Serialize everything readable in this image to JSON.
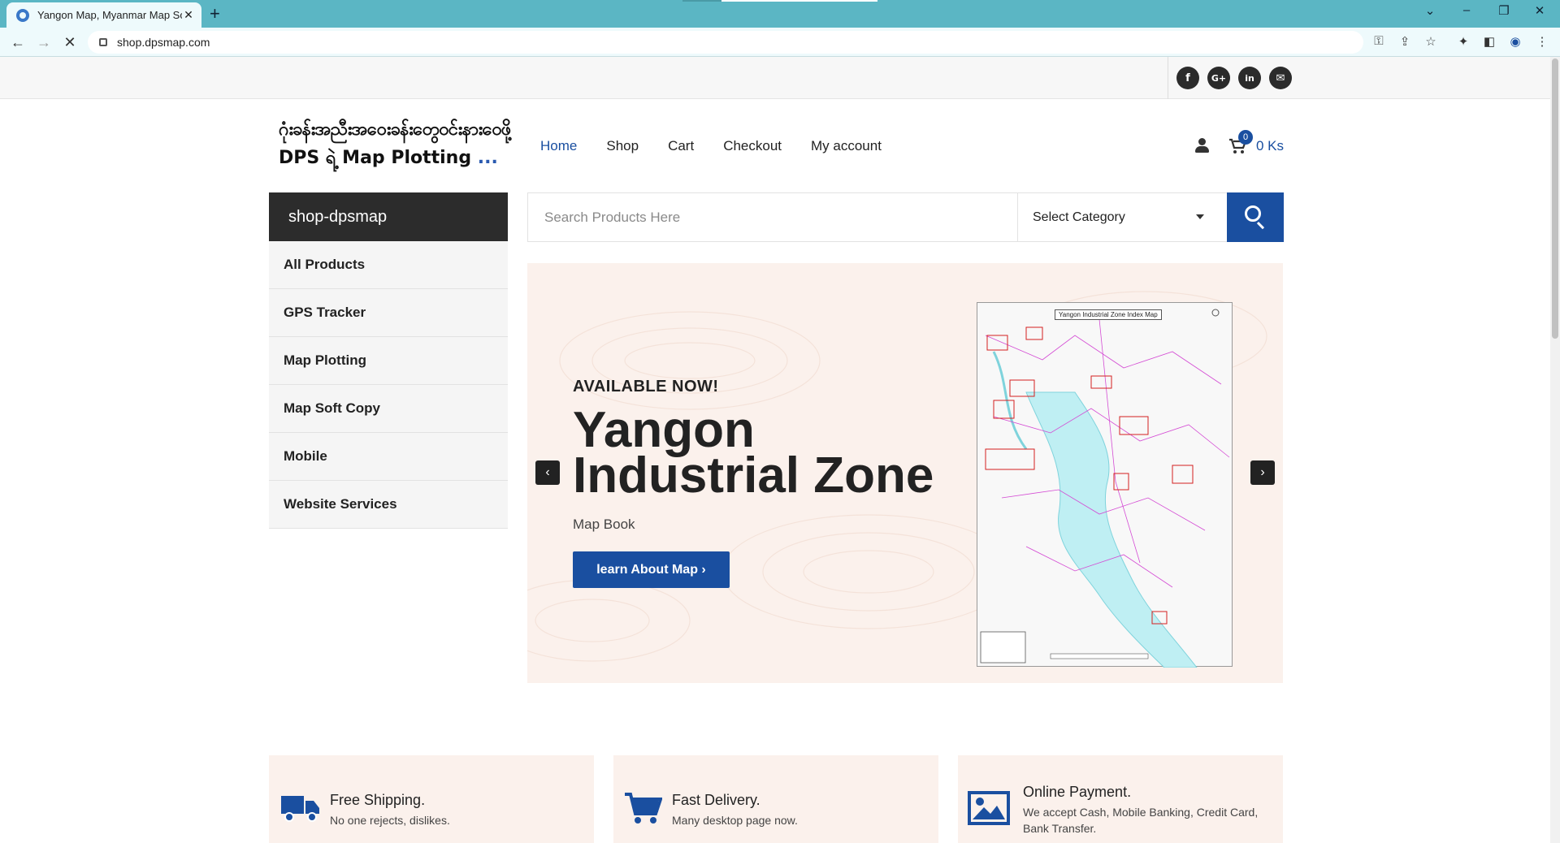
{
  "browser": {
    "tab_title": "Yangon Map, Myanmar Map Soft Copy",
    "url": "shop.dpsmap.com"
  },
  "social": {
    "facebook": "f",
    "googleplus": "G+",
    "linkedin": "in",
    "email": "✉"
  },
  "logo": {
    "line1": "ဂုံးခန်းအညီးအဝေးခန်းတွေဝင်းနားဝေဖို့",
    "line2": "DPS ရဲ့ Map Plotting",
    "dots": "..."
  },
  "nav": {
    "items": [
      "Home",
      "Shop",
      "Cart",
      "Checkout",
      "My account"
    ],
    "active": "Home"
  },
  "cart": {
    "count": "0",
    "total": "0 Ks"
  },
  "sidebar": {
    "title": "shop-dpsmap",
    "items": [
      "All Products",
      "GPS Tracker",
      "Map Plotting",
      "Map Soft Copy",
      "Mobile",
      "Website Services"
    ]
  },
  "search": {
    "placeholder": "Search Products Here",
    "category": "Select Category"
  },
  "hero": {
    "eyebrow": "AVAILABLE NOW!",
    "headline_line1": "Yangon",
    "headline_line2": "Industrial Zone",
    "subtitle": "Map Book",
    "cta": "learn About Map ›",
    "map_title": "Yangon Industrial Zone Index Map"
  },
  "features": [
    {
      "title": "Free Shipping.",
      "desc": "No one rejects, dislikes."
    },
    {
      "title": "Fast Delivery.",
      "desc": "Many desktop page now."
    },
    {
      "title": "Online Payment.",
      "desc": "We accept Cash, Mobile Banking, Credit Card, Bank Transfer."
    }
  ],
  "colors": {
    "tabbar": "#5bb6c4",
    "brand_blue": "#1a4fa0",
    "dark": "#2c2c2c",
    "hero_bg": "#fbf1ec"
  },
  "icons": [
    "truck-icon",
    "cart-icon",
    "image-icon",
    "user-icon",
    "search-icon"
  ]
}
